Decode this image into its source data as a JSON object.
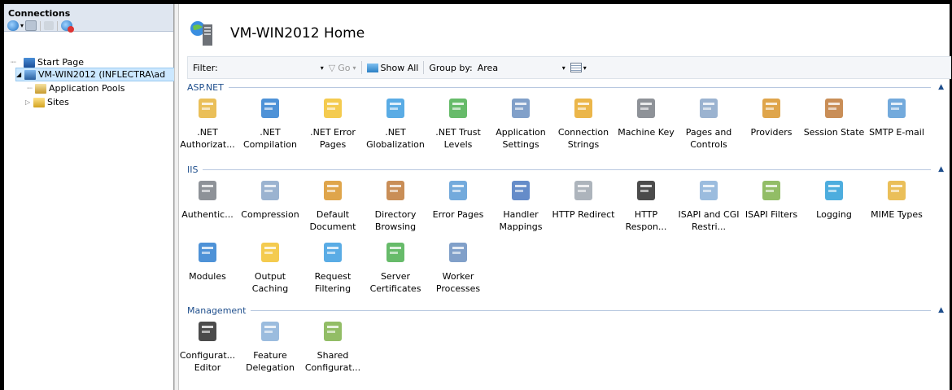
{
  "connections": {
    "title": "Connections",
    "tree": [
      {
        "label": "Start Page"
      },
      {
        "label": "VM-WIN2012 (INFLECTRA\\ad"
      },
      {
        "label": "Application Pools"
      },
      {
        "label": "Sites"
      }
    ]
  },
  "main": {
    "title": "VM-WIN2012 Home",
    "filterbar": {
      "filter_label": "Filter:",
      "filter_value": "",
      "go_label": "Go",
      "show_all_label": "Show All",
      "group_by_label": "Group by:",
      "group_by_value": "Area"
    },
    "sections": [
      {
        "title": "ASP.NET",
        "items": [
          {
            "label": ".NET Authorizat...",
            "icon": "authorization-icon"
          },
          {
            "label": ".NET Compilation",
            "icon": "compilation-icon"
          },
          {
            "label": ".NET Error Pages",
            "icon": "error-pages-icon"
          },
          {
            "label": ".NET Globalization",
            "icon": "globalization-icon"
          },
          {
            "label": ".NET Trust Levels",
            "icon": "trust-levels-icon"
          },
          {
            "label": "Application Settings",
            "icon": "app-settings-icon"
          },
          {
            "label": "Connection Strings",
            "icon": "connection-strings-icon"
          },
          {
            "label": "Machine Key",
            "icon": "machine-key-icon"
          },
          {
            "label": "Pages and Controls",
            "icon": "pages-controls-icon"
          },
          {
            "label": "Providers",
            "icon": "providers-icon"
          },
          {
            "label": "Session State",
            "icon": "session-state-icon"
          },
          {
            "label": "SMTP E-mail",
            "icon": "smtp-email-icon"
          }
        ]
      },
      {
        "title": "IIS",
        "items": [
          {
            "label": "Authentic...",
            "icon": "authentication-icon"
          },
          {
            "label": "Compression",
            "icon": "compression-icon"
          },
          {
            "label": "Default Document",
            "icon": "default-document-icon"
          },
          {
            "label": "Directory Browsing",
            "icon": "directory-browsing-icon"
          },
          {
            "label": "Error Pages",
            "icon": "error-pages-icon"
          },
          {
            "label": "Handler Mappings",
            "icon": "handler-mappings-icon"
          },
          {
            "label": "HTTP Redirect",
            "icon": "http-redirect-icon"
          },
          {
            "label": "HTTP Respon...",
            "icon": "http-response-icon"
          },
          {
            "label": "ISAPI and CGI Restri...",
            "icon": "isapi-cgi-icon"
          },
          {
            "label": "ISAPI Filters",
            "icon": "isapi-filters-icon"
          },
          {
            "label": "Logging",
            "icon": "logging-icon"
          },
          {
            "label": "MIME Types",
            "icon": "mime-types-icon"
          },
          {
            "label": "Modules",
            "icon": "modules-icon"
          },
          {
            "label": "Output Caching",
            "icon": "output-caching-icon"
          },
          {
            "label": "Request Filtering",
            "icon": "request-filtering-icon"
          },
          {
            "label": "Server Certificates",
            "icon": "server-certificates-icon"
          },
          {
            "label": "Worker Processes",
            "icon": "worker-processes-icon"
          }
        ]
      },
      {
        "title": "Management",
        "items": [
          {
            "label": "Configurat... Editor",
            "icon": "config-editor-icon"
          },
          {
            "label": "Feature Delegation",
            "icon": "feature-delegation-icon"
          },
          {
            "label": "Shared Configurat...",
            "icon": "shared-config-icon"
          }
        ]
      }
    ]
  }
}
